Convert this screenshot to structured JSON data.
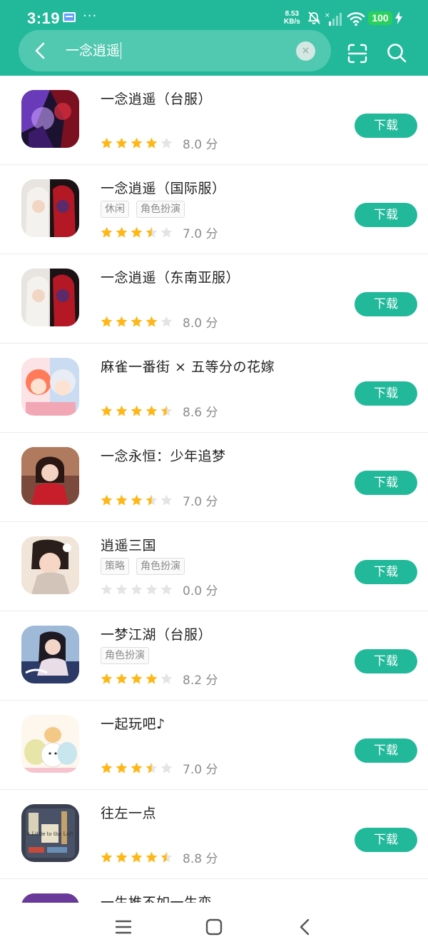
{
  "status_bar": {
    "time": "3:19",
    "more": "···",
    "speed_value": "8.53",
    "speed_unit": "KB/s",
    "battery": "100"
  },
  "search": {
    "query": "一念逍遥",
    "clear_glyph": "×"
  },
  "colors": {
    "brand": "#21b99a",
    "star_on": "#ffb718",
    "star_off": "#e4e4e4",
    "battery": "#2ad05c"
  },
  "results": [
    {
      "title": "一念逍遥（台服）",
      "tags": [],
      "stars": 4,
      "score": "8.0 分",
      "button": "下载",
      "icon": "dark-fantasy-app-icon"
    },
    {
      "title": "一念逍遥（国际服）",
      "tags": [
        "休闲",
        "角色扮演"
      ],
      "stars": 3.5,
      "score": "7.0 分",
      "button": "下载",
      "icon": "dual-character-app-icon"
    },
    {
      "title": "一念逍遥（东南亚服）",
      "tags": [],
      "stars": 4,
      "score": "8.0 分",
      "button": "下载",
      "icon": "dual-character-app-icon"
    },
    {
      "title": "麻雀一番街 × 五等分の花嫁",
      "tags": [],
      "stars": 4.5,
      "score": "8.6 分",
      "button": "下载",
      "icon": "anime-girls-app-icon"
    },
    {
      "title": "一念永恒：少年追梦",
      "tags": [],
      "stars": 3.5,
      "score": "7.0 分",
      "button": "下载",
      "icon": "red-dress-app-icon"
    },
    {
      "title": "逍遥三国",
      "tags": [
        "策略",
        "角色扮演"
      ],
      "stars": 0,
      "score": "0.0 分",
      "button": "下载",
      "icon": "three-kingdoms-app-icon"
    },
    {
      "title": "一梦江湖（台服）",
      "tags": [
        "角色扮演"
      ],
      "stars": 4,
      "score": "8.2 分",
      "button": "下载",
      "icon": "jianghu-app-icon"
    },
    {
      "title": "一起玩吧♪",
      "tags": [],
      "stars": 3.5,
      "score": "7.0 分",
      "button": "下载",
      "icon": "cute-animals-app-icon"
    },
    {
      "title": "往左一点",
      "tags": [],
      "stars": 4.5,
      "score": "8.8 分",
      "button": "下载",
      "icon": "a-little-left-app-icon"
    },
    {
      "title": "一生推不如一生恋",
      "tags": [],
      "stars": 0,
      "score": "",
      "button": "",
      "icon": "anime-app-icon"
    }
  ],
  "a_little_left_icon_text": "A Little to the Left",
  "nav": {
    "menu_icon": "menu-icon",
    "home_icon": "home-icon",
    "back_icon": "back-icon"
  }
}
